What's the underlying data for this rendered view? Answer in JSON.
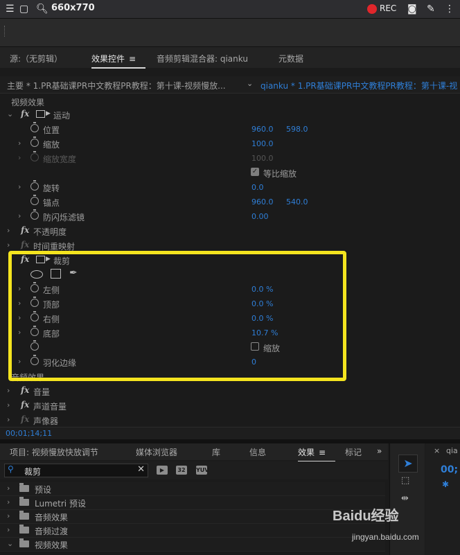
{
  "topbar": {
    "size": "660x770",
    "rec": "REC",
    "icons": [
      "menu-icon",
      "window-icon",
      "search-icon",
      "camera-icon",
      "pen-icon",
      "more-icon"
    ]
  },
  "tabs": [
    {
      "label": "源:（无剪辑）"
    },
    {
      "label": "效果控件"
    },
    {
      "label": "音频剪辑混合器: qianku"
    },
    {
      "label": "元数据"
    }
  ],
  "source": {
    "left": "主要 * 1.PR基础课PR中文教程PR教程：第十课-视频慢放...",
    "right": "qianku * 1.PR基础课PR中文教程PR教程：第十课-视"
  },
  "effects": {
    "video_header": "视频效果",
    "motion": "运动",
    "position": {
      "label": "位置",
      "x": "960.0",
      "y": "598.0"
    },
    "scale": {
      "label": "缩放",
      "value": "100.0"
    },
    "scale_width": {
      "label": "缩放宽度",
      "value": "100.0"
    },
    "uniform": "等比缩放",
    "rotation": {
      "label": "旋转",
      "value": "0.0"
    },
    "anchor": {
      "label": "锚点",
      "x": "960.0",
      "y": "540.0"
    },
    "antiflicker": {
      "label": "防闪烁滤镜",
      "value": "0.00"
    },
    "opacity": "不透明度",
    "timeremap": "时间重映射",
    "crop": "裁剪",
    "left": {
      "label": "左侧",
      "value": "0.0 %"
    },
    "top": {
      "label": "顶部",
      "value": "0.0 %"
    },
    "right": {
      "label": "右侧",
      "value": "0.0 %"
    },
    "bottom": {
      "label": "底部",
      "value": "10.7 %"
    },
    "zoom": "缩放",
    "feather": {
      "label": "羽化边缘",
      "value": "0"
    },
    "audio_header": "音频效果",
    "volume": "音量",
    "channel_volume": "声道音量",
    "panner": "声像器"
  },
  "timecode": "00;01;14;11",
  "bottom_tabs": [
    {
      "label": "项目: 视频慢放快放调节"
    },
    {
      "label": "媒体浏览器"
    },
    {
      "label": "库"
    },
    {
      "label": "信息"
    },
    {
      "label": "效果"
    },
    {
      "label": "标记"
    }
  ],
  "more": "»",
  "search": {
    "value": "裁剪"
  },
  "badges": [
    "32",
    "YUV"
  ],
  "folders": [
    "预设",
    "Lumetri 预设",
    "音频效果",
    "音频过渡",
    "视频效果"
  ],
  "timeline": {
    "name": "qia",
    "tc": "00;"
  },
  "watermark": {
    "brand": "Baidu经验",
    "url": "jingyan.baidu.com"
  }
}
